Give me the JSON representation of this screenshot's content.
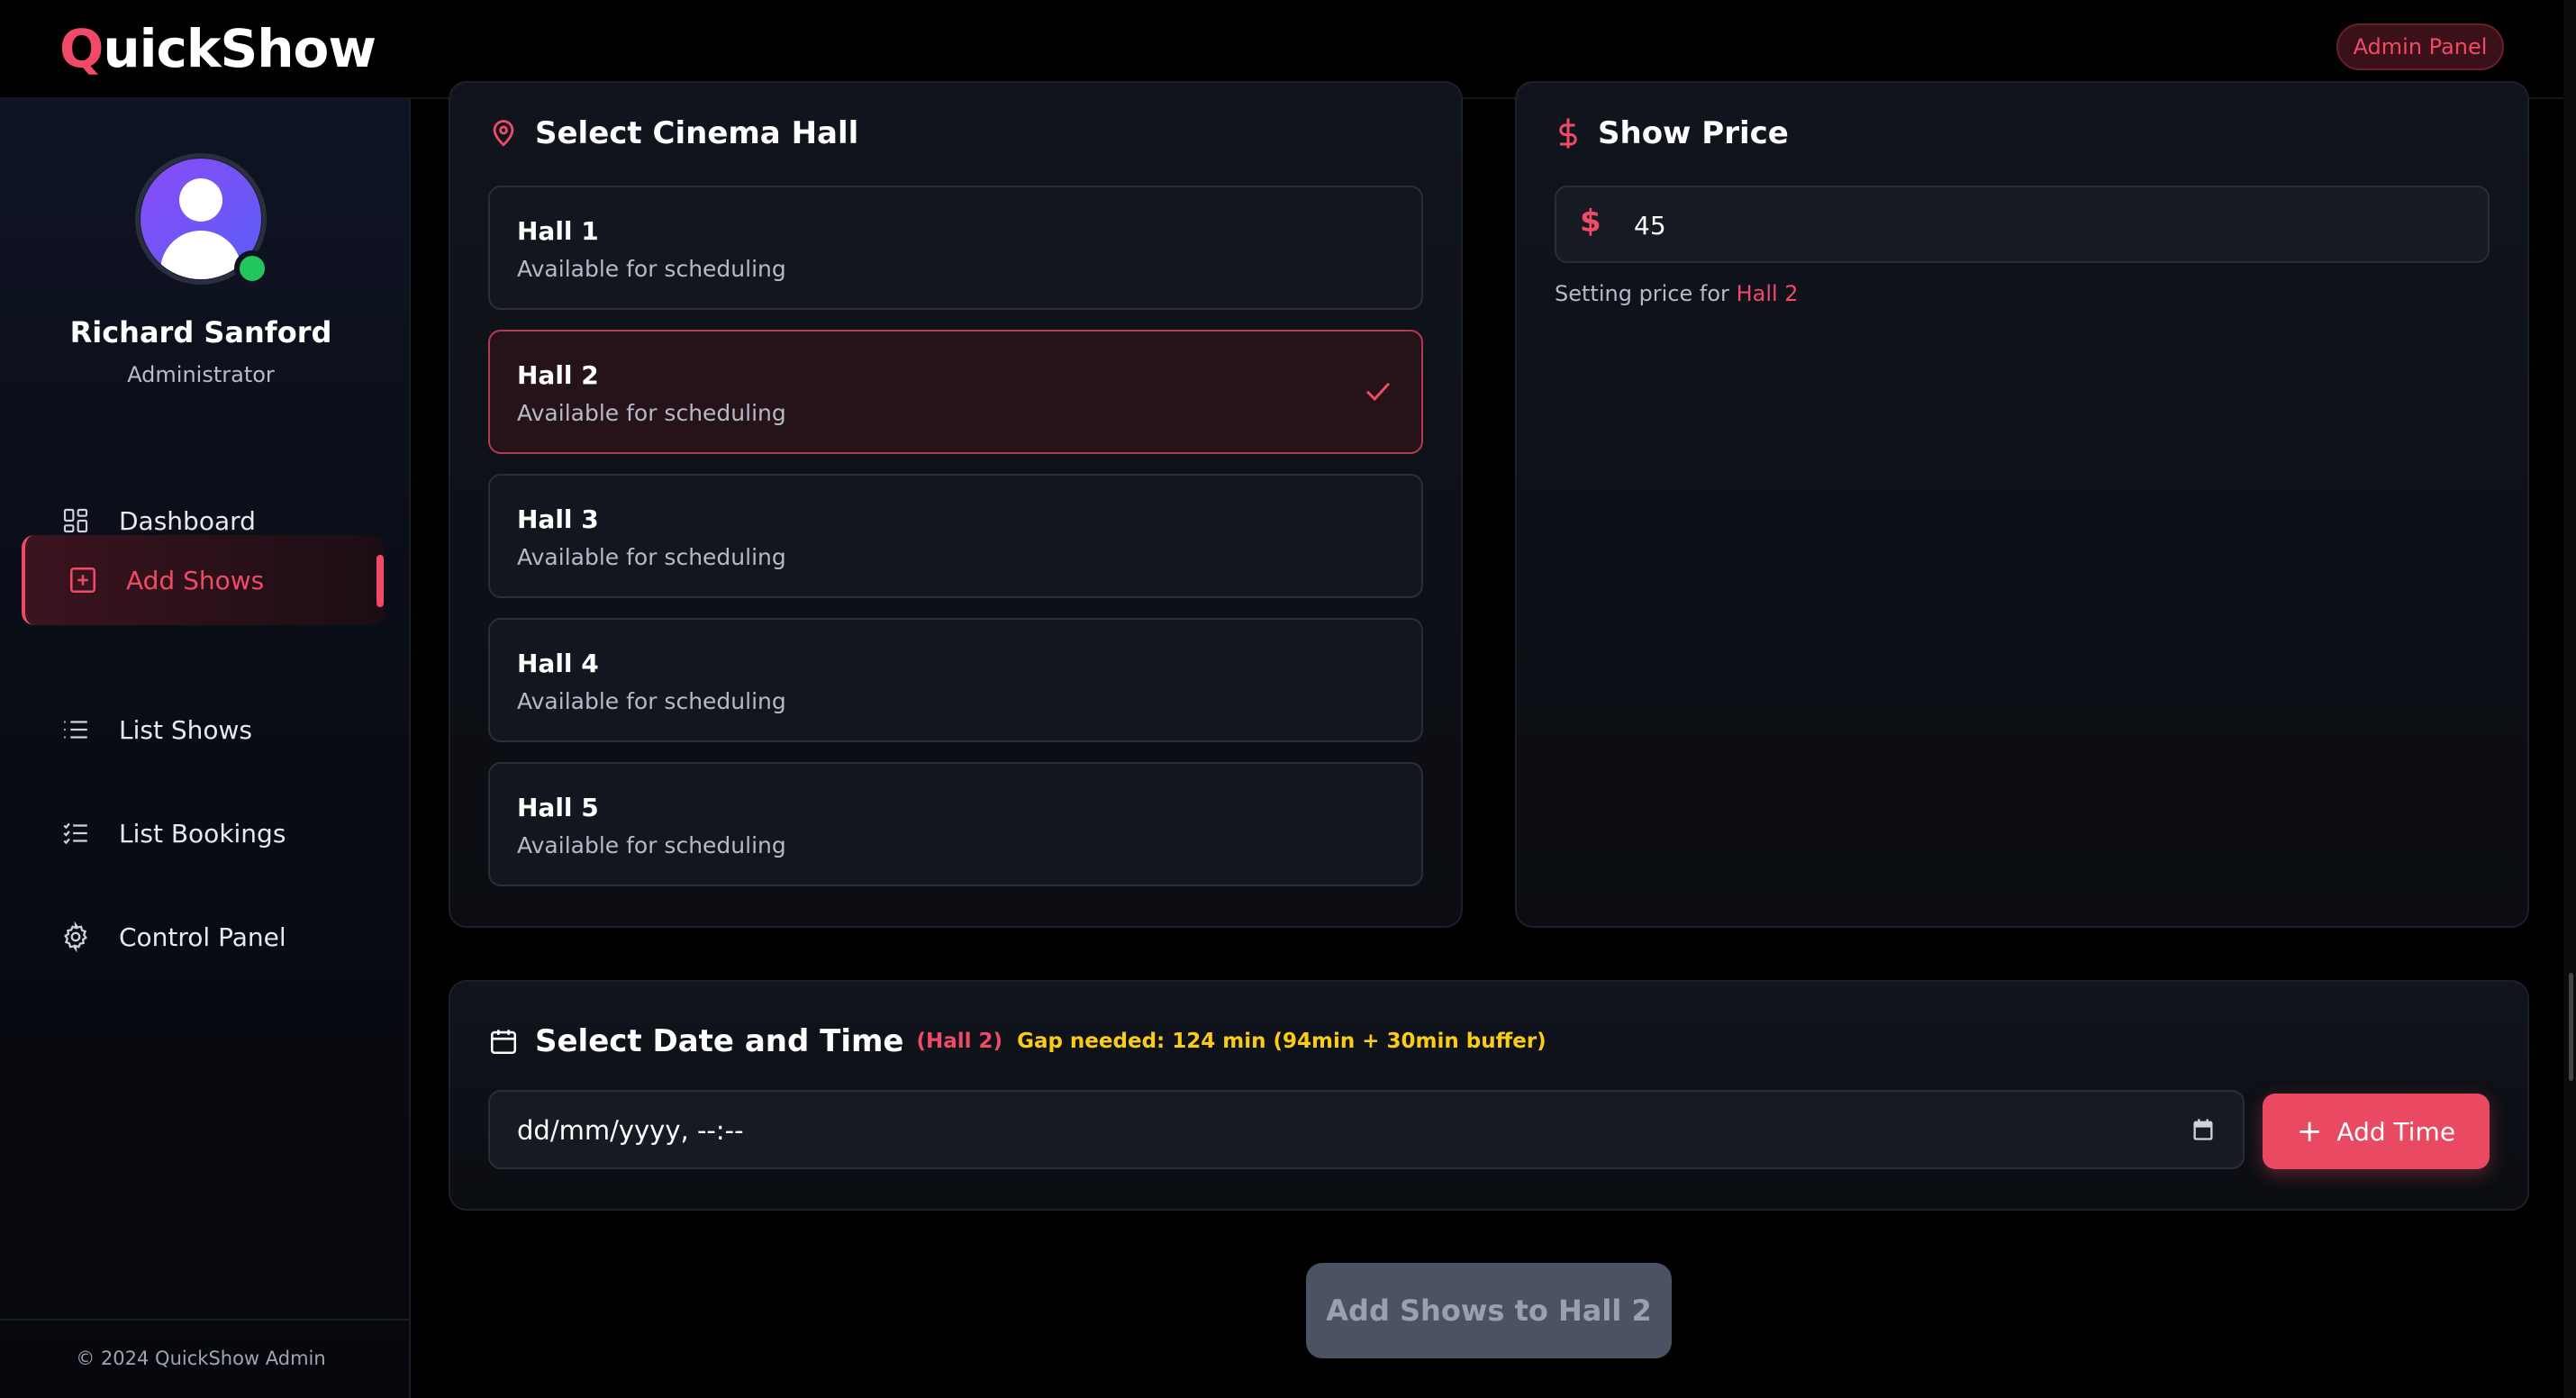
{
  "header": {
    "logo_first": "Q",
    "logo_rest": "uickShow",
    "badge": "Admin Panel"
  },
  "sidebar": {
    "user": {
      "name": "Richard Sanford",
      "role": "Administrator",
      "status": "online"
    },
    "items": [
      {
        "label": "Dashboard",
        "icon": "dashboard-icon",
        "active": false
      },
      {
        "label": "Add Shows",
        "icon": "plus-square-icon",
        "active": true
      },
      {
        "label": "List Shows",
        "icon": "list-icon",
        "active": false
      },
      {
        "label": "List Bookings",
        "icon": "list-ordered-icon",
        "active": false
      },
      {
        "label": "Control Panel",
        "icon": "gear-icon",
        "active": false
      }
    ],
    "footer": "© 2024 QuickShow Admin"
  },
  "hall_section": {
    "title": "Select Cinema Hall",
    "halls": [
      {
        "name": "Hall 1",
        "status": "Available for scheduling",
        "selected": false
      },
      {
        "name": "Hall 2",
        "status": "Available for scheduling",
        "selected": true
      },
      {
        "name": "Hall 3",
        "status": "Available for scheduling",
        "selected": false
      },
      {
        "name": "Hall 4",
        "status": "Available for scheduling",
        "selected": false
      },
      {
        "name": "Hall 5",
        "status": "Available for scheduling",
        "selected": false
      }
    ]
  },
  "price_section": {
    "title": "Show Price",
    "currency_symbol": "$",
    "value": "45",
    "note_prefix": "Setting price for",
    "note_hall": "Hall 2"
  },
  "datetime_section": {
    "title": "Select Date and Time",
    "hall_tag": "(Hall 2)",
    "gap_text": "Gap needed: 124 min (94min + 30min buffer)",
    "placeholder": "dd/mm/yyyy, --:--",
    "add_button": "Add Time"
  },
  "submit_button": "Add Shows to Hall 2",
  "colors": {
    "accent": "#f14a66",
    "warning": "#facc15",
    "online": "#22c55e"
  }
}
